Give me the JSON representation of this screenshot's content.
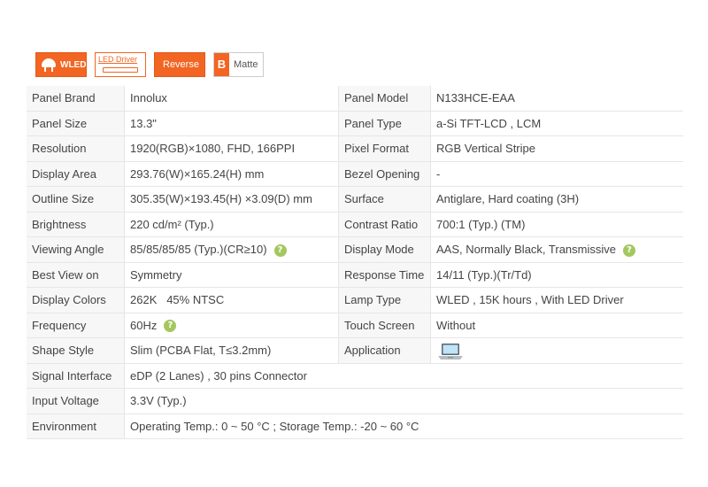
{
  "badges": {
    "wled": "WLED",
    "led_driver": "LED Driver",
    "reverse": "Reverse",
    "matte_icon": "B",
    "matte": "Matte"
  },
  "specs": {
    "panel_brand": {
      "label": "Panel Brand",
      "value": "Innolux"
    },
    "panel_model": {
      "label": "Panel Model",
      "value": "N133HCE-EAA"
    },
    "panel_size": {
      "label": "Panel Size",
      "value": "13.3\""
    },
    "panel_type": {
      "label": "Panel Type",
      "value": "a-Si TFT-LCD , LCM"
    },
    "resolution": {
      "label": "Resolution",
      "value": "1920(RGB)×1080, FHD, 166PPI"
    },
    "pixel_format": {
      "label": "Pixel Format",
      "value": "RGB Vertical Stripe"
    },
    "display_area": {
      "label": "Display Area",
      "value": "293.76(W)×165.24(H) mm"
    },
    "bezel_opening": {
      "label": "Bezel Opening",
      "value": "-"
    },
    "outline_size": {
      "label": "Outline Size",
      "value": "305.35(W)×193.45(H) ×3.09(D) mm"
    },
    "surface": {
      "label": "Surface",
      "value": "Antiglare, Hard coating (3H)"
    },
    "brightness": {
      "label": "Brightness",
      "value": "220 cd/m² (Typ.)"
    },
    "contrast_ratio": {
      "label": "Contrast Ratio",
      "value": "700:1 (Typ.) (TM)"
    },
    "viewing_angle": {
      "label": "Viewing Angle",
      "value": "85/85/85/85 (Typ.)(CR≥10)"
    },
    "display_mode": {
      "label": "Display Mode",
      "value": "AAS, Normally Black, Transmissive"
    },
    "best_view": {
      "label": "Best View on",
      "value": "Symmetry"
    },
    "response_time": {
      "label": "Response Time",
      "value": "14/11 (Typ.)(Tr/Td)"
    },
    "display_colors": {
      "label": "Display Colors",
      "value": "262K   45% NTSC"
    },
    "lamp_type": {
      "label": "Lamp Type",
      "value": "WLED , 15K hours , With LED Driver"
    },
    "frequency": {
      "label": "Frequency",
      "value": "60Hz"
    },
    "touch_screen": {
      "label": "Touch Screen",
      "value": "Without"
    },
    "shape_style": {
      "label": "Shape Style",
      "value": "Slim (PCBA Flat, T≤3.2mm)"
    },
    "application": {
      "label": "Application",
      "value": "",
      "icon": "laptop-icon"
    },
    "signal_interface": {
      "label": "Signal Interface",
      "value": "eDP (2 Lanes) , 30 pins Connector"
    },
    "input_voltage": {
      "label": "Input Voltage",
      "value": "3.3V (Typ.)"
    },
    "environment": {
      "label": "Environment",
      "value": "Operating Temp.: 0 ~ 50 °C ; Storage Temp.: -20 ~ 60 °C"
    }
  },
  "help_glyph": "?",
  "colors": {
    "accent": "#f26522",
    "help": "#a4c75f",
    "label_bg": "#f7f7f7",
    "border": "#e6e6e6"
  }
}
